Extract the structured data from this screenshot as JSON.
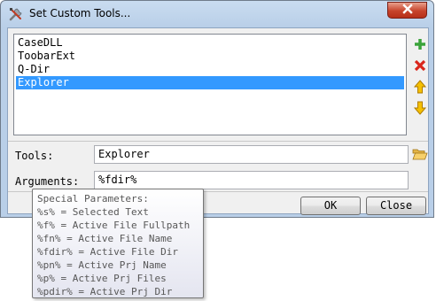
{
  "window": {
    "title": "Set Custom Tools..."
  },
  "tools_list": {
    "items": [
      "CaseDLL",
      "ToobarExt",
      "Q-Dir",
      "Explorer"
    ],
    "selected_index": 3
  },
  "form": {
    "tools_label": "Tools:",
    "tools_value": "Explorer",
    "arguments_label": "Arguments:",
    "arguments_value": "%fdir%"
  },
  "buttons": {
    "ok": "OK",
    "close": "Close"
  },
  "tooltip": {
    "lines": [
      "Special Parameters:",
      "%s% = Selected Text",
      "%f% = Active File Fullpath",
      "%fn% = Active File Name",
      "%fdir% = Active File Dir",
      "%pn% = Active Prj Name",
      "%p% = Active Prj Files",
      "%pdir% = Active Prj Dir"
    ]
  },
  "icons": {
    "app": "tools-icon",
    "close": "close-icon",
    "add": "add-icon",
    "delete": "delete-icon",
    "move_up": "arrow-up-icon",
    "move_down": "arrow-down-icon",
    "browse": "folder-open-icon"
  },
  "colors": {
    "selection": "#3399ff",
    "add": "#3aa33a",
    "delete": "#d9261c",
    "arrows": "#f0b400"
  }
}
